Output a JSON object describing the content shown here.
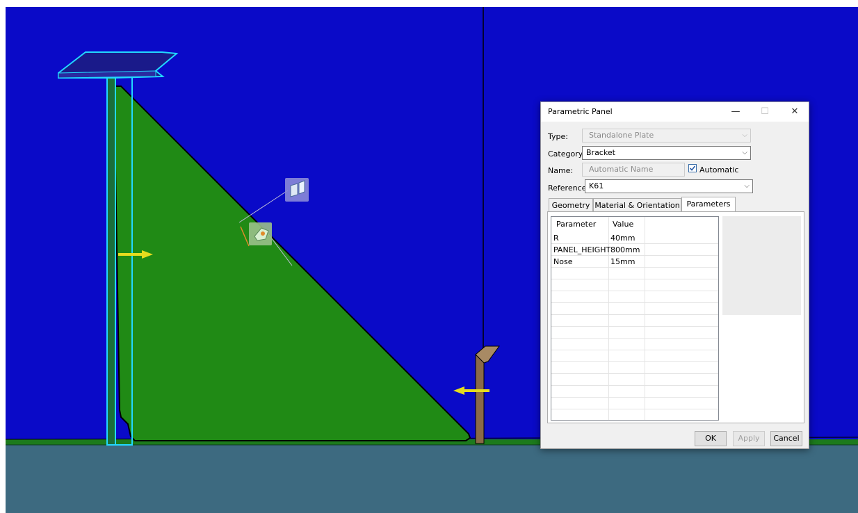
{
  "dialog": {
    "title": "Parametric Panel",
    "window_buttons": {
      "minimize": "—",
      "maximize": "☐",
      "close": "✕"
    },
    "type": {
      "label": "Type:",
      "value": "Standalone Plate"
    },
    "category": {
      "label": "Category:",
      "value": "Bracket"
    },
    "name": {
      "label": "Name:",
      "value": "Automatic Name",
      "automatic_label": "Automatic",
      "automatic_checked": true
    },
    "reference": {
      "label": "Reference:",
      "value": "K61"
    },
    "tabs": [
      {
        "label": "Geometry",
        "active": false
      },
      {
        "label": "Material & Orientation",
        "active": false
      },
      {
        "label": "Parameters",
        "active": true
      }
    ],
    "grid": {
      "columns": [
        "Parameter",
        "Value"
      ],
      "rows": [
        {
          "parameter": "R",
          "value": "40mm"
        },
        {
          "parameter": "PANEL_HEIGHT",
          "value": "800mm"
        },
        {
          "parameter": "Nose",
          "value": "15mm"
        }
      ]
    },
    "buttons": {
      "ok": "OK",
      "apply": "Apply",
      "cancel": "Cancel"
    }
  },
  "scene_colors": {
    "background": "#0a0ac8",
    "plate": "#208a15",
    "floor": "#3d6a80",
    "floor_edge": "#1c7a1c",
    "selection": "#22d8ff",
    "arrow": "#e6dc1e",
    "post": "#8a6a48"
  }
}
